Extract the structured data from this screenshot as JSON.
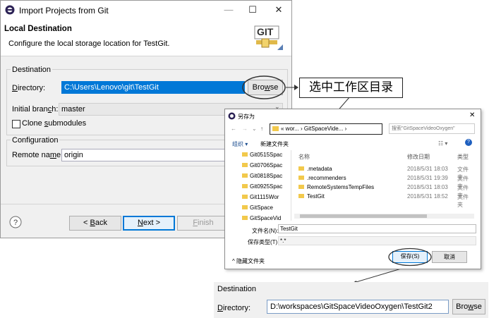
{
  "main_dialog": {
    "title": "Import Projects from Git",
    "header_title": "Local Destination",
    "header_desc": "Configure the local storage location for TestGit.",
    "logo_text": "GIT",
    "destination_group": "Destination",
    "directory_label": "Directory:",
    "directory_value": "C:\\Users\\Lenovo\\git\\TestGit",
    "browse_label": "Browse",
    "branch_label": "Initial branch:",
    "branch_value": "master",
    "clone_submodules": "Clone submodules",
    "config_group": "Configuration",
    "remote_label": "Remote name:",
    "remote_value": "origin",
    "back_label": "< Back",
    "next_label": "Next >",
    "finish_label": "Finish"
  },
  "annotation": {
    "callout": "选中工作区目录"
  },
  "save_dialog": {
    "title": "另存为",
    "breadcrumb": "« wor... › GitSpaceVide... ›",
    "search_placeholder": "搜索\"GitSpaceVideoOxygen\"",
    "organize": "组织 ▾",
    "new_folder": "新建文件夹",
    "sidebar": [
      "Git0515Spac",
      "Git0706Spac",
      "Git0818Spac",
      "Git0925Spac",
      "Git1115Wor",
      "GitSpace",
      "GitSpaceVid"
    ],
    "col_name": "名称",
    "col_date": "修改日期",
    "col_type": "类型",
    "files": [
      {
        "name": ".metadata",
        "date": "2018/5/31 18:03",
        "type": "文件夹"
      },
      {
        "name": ".recommenders",
        "date": "2018/5/31 19:39",
        "type": "文件夹"
      },
      {
        "name": "RemoteSystemsTempFiles",
        "date": "2018/5/31 18:03",
        "type": "文件夹"
      },
      {
        "name": "TestGit",
        "date": "2018/5/31 18:52",
        "type": "文件夹"
      }
    ],
    "filename_label": "文件名(N):",
    "filename_value": "TestGit",
    "filetype_label": "保存类型(T):",
    "filetype_value": "*.*",
    "hide_folders": "隐藏文件夹",
    "save_label": "保存(S)",
    "cancel_label": "取消"
  },
  "result_panel": {
    "group": "Destination",
    "directory_label": "Directory:",
    "directory_value": "D:\\workspaces\\GitSpaceVideoOxygen\\TestGit2",
    "browse_label": "Browse"
  },
  "colors": {
    "selection": "#0078d7",
    "accent": "#316ac5"
  }
}
